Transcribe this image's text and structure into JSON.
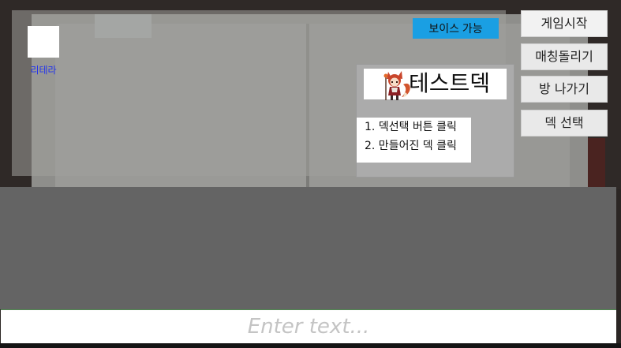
{
  "room": {
    "voice_badge": "보이스 가능",
    "player": {
      "name": "리테라"
    }
  },
  "deck": {
    "title": "테스트덱",
    "avatar_icon": "fox-character-icon",
    "steps": [
      "1. 덱선택 버튼 클릭",
      "2. 만들어진 덱 클릭"
    ]
  },
  "buttons": {
    "start_game": "게임시작",
    "matching": "매칭돌리기",
    "leave_room": "방 나가기",
    "select_deck": "덱 선택"
  },
  "chat": {
    "input_value": "",
    "placeholder": "Enter text..."
  },
  "colors": {
    "voice_badge": "#1a9fe3",
    "player_name": "#2233ee",
    "chat_area": "#646464"
  }
}
